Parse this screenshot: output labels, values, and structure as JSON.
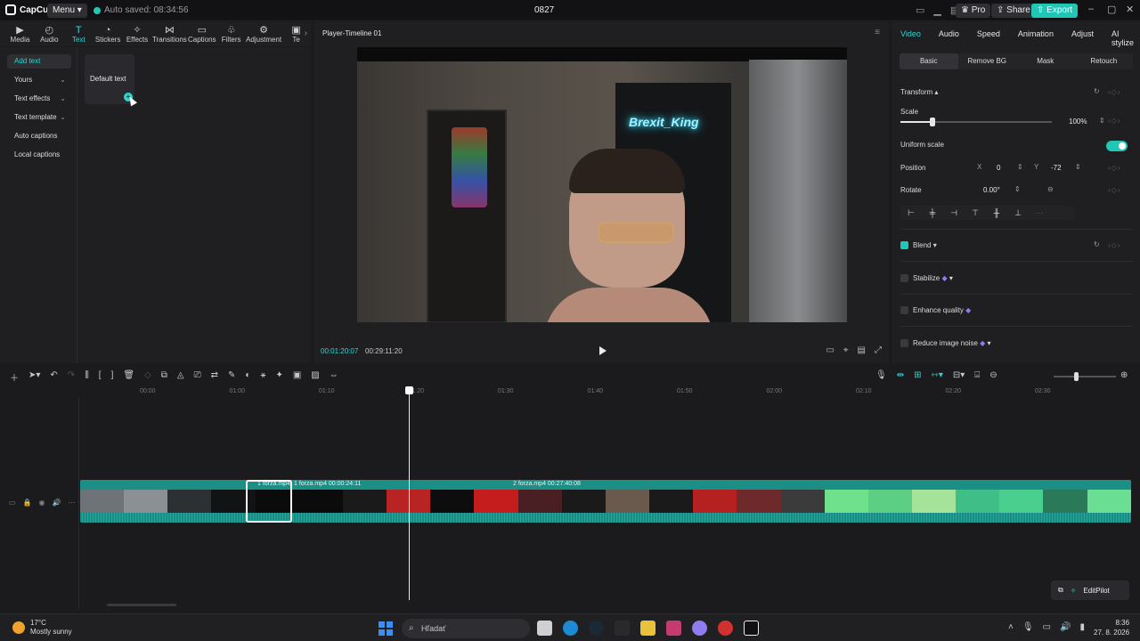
{
  "window": {
    "app_name": "CapCut",
    "menu_label": "Menu",
    "autosave": "Auto saved: 08:34:56",
    "project_title": "0827",
    "pro_label": "Pro",
    "share_label": "Share",
    "export_label": "Export"
  },
  "left_toolbar": {
    "tools": [
      {
        "label": "Media",
        "icon": "media-icon"
      },
      {
        "label": "Audio",
        "icon": "audio-icon"
      },
      {
        "label": "Text",
        "icon": "text-icon"
      },
      {
        "label": "Stickers",
        "icon": "stickers-icon"
      },
      {
        "label": "Effects",
        "icon": "effects-icon"
      },
      {
        "label": "Transitions",
        "icon": "transitions-icon"
      },
      {
        "label": "Captions",
        "icon": "captions-icon"
      },
      {
        "label": "Filters",
        "icon": "filters-icon"
      },
      {
        "label": "Adjustment",
        "icon": "adjustment-icon"
      },
      {
        "label": "Te",
        "icon": "template-icon"
      }
    ],
    "active": "Text"
  },
  "text_menu": {
    "items": [
      "Add text",
      "Yours",
      "Text effects",
      "Text template",
      "Auto captions",
      "Local captions"
    ],
    "default_card": "Default text"
  },
  "player": {
    "title": "Player-Timeline 01",
    "current_time": "00:01:20:07",
    "total_time": "00:29:11:20",
    "neon_text": "Brexit_King"
  },
  "right_panel": {
    "tabs": [
      "Video",
      "Audio",
      "Speed",
      "Animation",
      "Adjust",
      "AI stylize"
    ],
    "subtabs": [
      "Basic",
      "Remove BG",
      "Mask",
      "Retouch"
    ],
    "transform": "Transform",
    "scale_label": "Scale",
    "scale_value": "100%",
    "scale_fraction": 0.21,
    "uniform_scale": "Uniform scale",
    "position_label": "Position",
    "x_label": "X",
    "x_value": "0",
    "y_label": "Y",
    "y_value": "-72",
    "rotate_label": "Rotate",
    "rotate_value": "0.00°",
    "blend": "Blend",
    "stabilize": "Stabilize",
    "enhance_quality": "Enhance quality",
    "reduce_noise": "Reduce image noise"
  },
  "timeline": {
    "ruler": [
      "00:00",
      "01:00",
      "01:10",
      "01:20",
      "01:30",
      "01:40",
      "01:50",
      "02:00",
      "02:10",
      "02:20",
      "02:30"
    ],
    "clip1": "1 forza.mp4",
    "clip2": "1 forza.mp4  00:00:24:11",
    "clip3": "2 forza.mp4  00:27:40:08",
    "editpilot": "EditPilot"
  },
  "taskbar": {
    "temperature": "17°C",
    "weather": "Mostly sunny",
    "search_placeholder": "Hľadať",
    "time": "8:36",
    "date": "27. 8. 2026"
  },
  "colors": {
    "accent": "#2fd7d2",
    "clip": "#157a73",
    "panel": "#1f1f22"
  }
}
